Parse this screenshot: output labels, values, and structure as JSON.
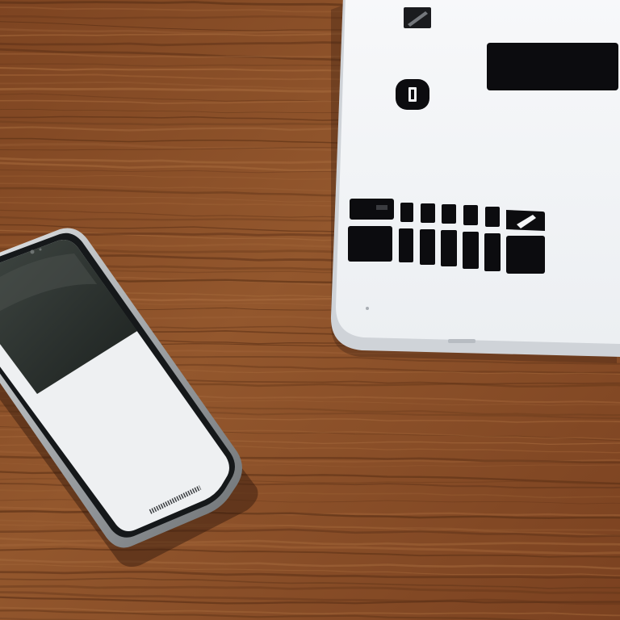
{
  "scene": {
    "colors": {
      "wood_base": "#8a4f27",
      "wood_light": "#a3673a",
      "wood_dark": "#5e3217",
      "tablet_body": "#f4f5f7",
      "tablet_edge": "#d2d6db",
      "tablet_marks": "#0c0c0f",
      "phone_frame": "#b9bdc0",
      "phone_bezel": "#15181a",
      "phone_screen_dark": "#2a302d",
      "phone_screen_light": "#eef0f2"
    },
    "objects": [
      {
        "name": "wooden-table-surface",
        "kind": "background"
      },
      {
        "name": "white-tablet",
        "kind": "device",
        "screen_text": ""
      },
      {
        "name": "smartphone",
        "kind": "device",
        "screen_text": ""
      }
    ]
  }
}
